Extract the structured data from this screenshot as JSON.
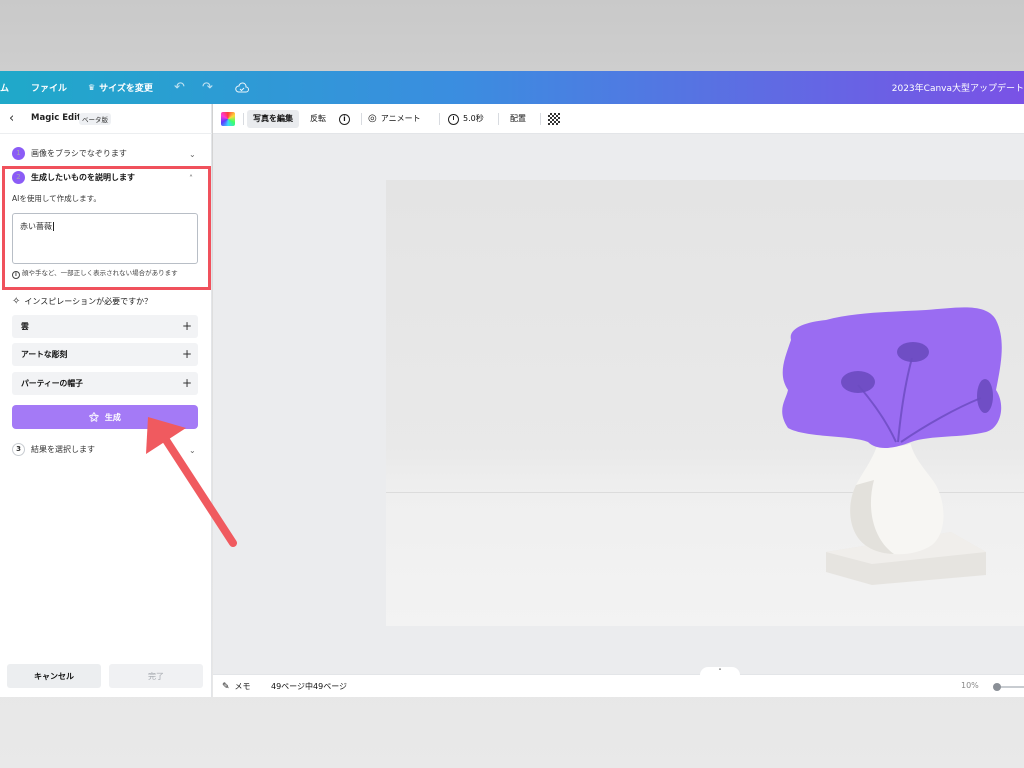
{
  "topbar": {
    "home_partial": "ム",
    "file": "ファイル",
    "resize": "サイズを変更",
    "resize_icon": "crown-icon",
    "undo_icon": "undo-icon",
    "redo_icon": "redo-icon",
    "cloud_icon": "cloud-check-icon",
    "doc_title": "2023年Canva大型アップデート",
    "gradient": [
      "#1fa9c9",
      "#7a52e6"
    ]
  },
  "panel": {
    "title": "Magic Edit",
    "badge": "ベータ版",
    "step1": {
      "num": "1",
      "label": "画像をブラシでなぞります"
    },
    "step2": {
      "num": "2",
      "label": "生成したいものを説明します",
      "desc": "AIを使用して作成します。",
      "prompt_value": "赤い薔薇",
      "warning": "顔や手など、一部正しく表示されない場合があります"
    },
    "inspiration": {
      "title": "インスピレーションが必要ですか？",
      "options": [
        "雲",
        "アートな彫刻",
        "パーティーの帽子"
      ]
    },
    "generate": "生成",
    "step3": {
      "num": "3",
      "label": "結果を選択します"
    },
    "cancel": "キャンセル",
    "done": "完了"
  },
  "toolbar": {
    "edit_photo": "写真を編集",
    "flip": "反転",
    "animate": "アニメート",
    "duration": "5.0秒",
    "position": "配置"
  },
  "bottombar": {
    "notes": "メモ",
    "pages": "49ページ中49ページ",
    "zoom": "10%"
  },
  "colors": {
    "accent_purple": "#8b5cf6",
    "mask_purple": "#9a6cf2",
    "highlight_red": "#f0515c"
  }
}
